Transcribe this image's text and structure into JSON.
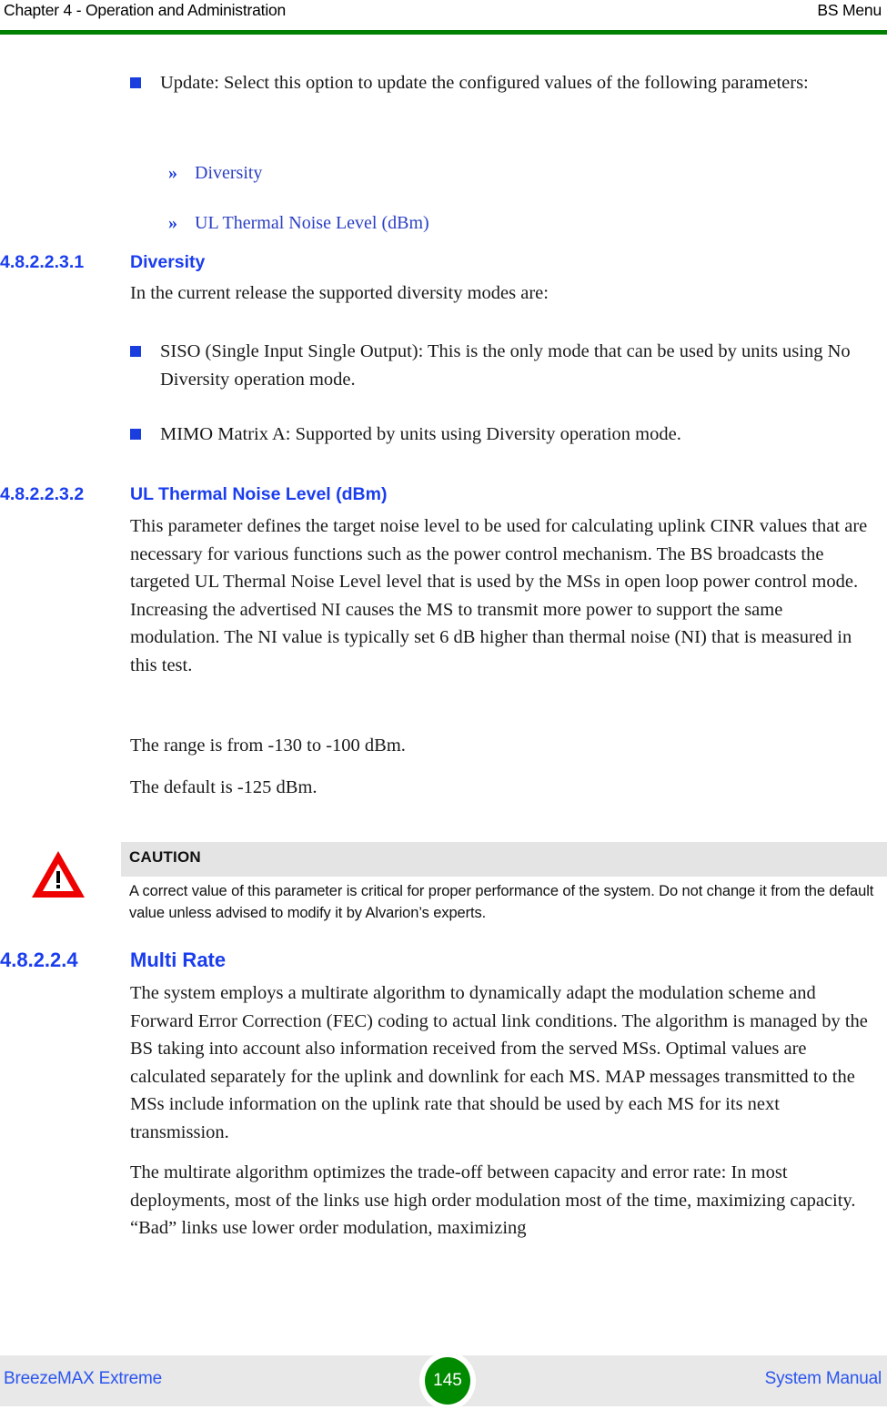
{
  "header": {
    "chapter": "Chapter 4 - Operation and Administration",
    "section": "BS Menu",
    "rule_color": "#008000"
  },
  "content": {
    "intro_bullet": "Update: Select this option to update the configured values of the following parameters:",
    "intro_sub_items": [
      {
        "marker": "»",
        "label": "Diversity"
      },
      {
        "marker": "»",
        "label": "UL Thermal Noise Level (dBm)"
      }
    ],
    "sections": [
      {
        "number": "4.8.2.2.3.1",
        "title": "Diversity",
        "intro": "In the current release the supported diversity modes are:",
        "bullets": [
          "SISO (Single Input Single Output): This is the only mode that can be used by units using No Diversity operation mode.",
          "MIMO Matrix A: Supported by units using Diversity operation mode."
        ]
      },
      {
        "number": "4.8.2.2.3.2",
        "title": "UL Thermal Noise Level (dBm)",
        "paragraphs": [
          "This parameter defines the target noise level to be used for calculating uplink CINR values that are necessary for various functions such as the power control mechanism. The BS broadcasts the targeted UL Thermal Noise Level level that is used by the MSs in open loop power control mode. Increasing the advertised NI causes the MS to transmit more power to support the same modulation. The NI value is typically set 6 dB higher than thermal noise (NI) that is measured in this test.",
          "The range is from -130 to -100 dBm.",
          "The default is -125 dBm."
        ]
      },
      {
        "number": "4.8.2.2.4",
        "title": "Multi Rate",
        "paragraphs": [
          "The system employs a multirate algorithm to dynamically adapt the modulation scheme and Forward Error Correction (FEC) coding to actual link conditions. The algorithm is managed by the BS taking into account also information received from the served MSs. Optimal values are calculated separately for the uplink and downlink for each MS. MAP messages transmitted to the MSs include information on the uplink rate that should be used by each MS for its next transmission.",
          "The multirate algorithm optimizes the trade-off between capacity and error rate: In most deployments, most of the links use high order modulation most of the time, maximizing capacity. “Bad” links use lower order modulation, maximizing"
        ]
      }
    ],
    "caution": {
      "label": "CAUTION",
      "text": "A correct value of this parameter is critical for proper performance of the system. Do not change it from the default value unless advised to modify it by Alvarion’s experts.",
      "icon_color": "#ee0000",
      "bar_color": "#e4e4e4"
    }
  },
  "footer": {
    "left": "BreezeMAX Extreme",
    "page": "145",
    "right": "System Manual",
    "badge_color": "#008a00"
  }
}
